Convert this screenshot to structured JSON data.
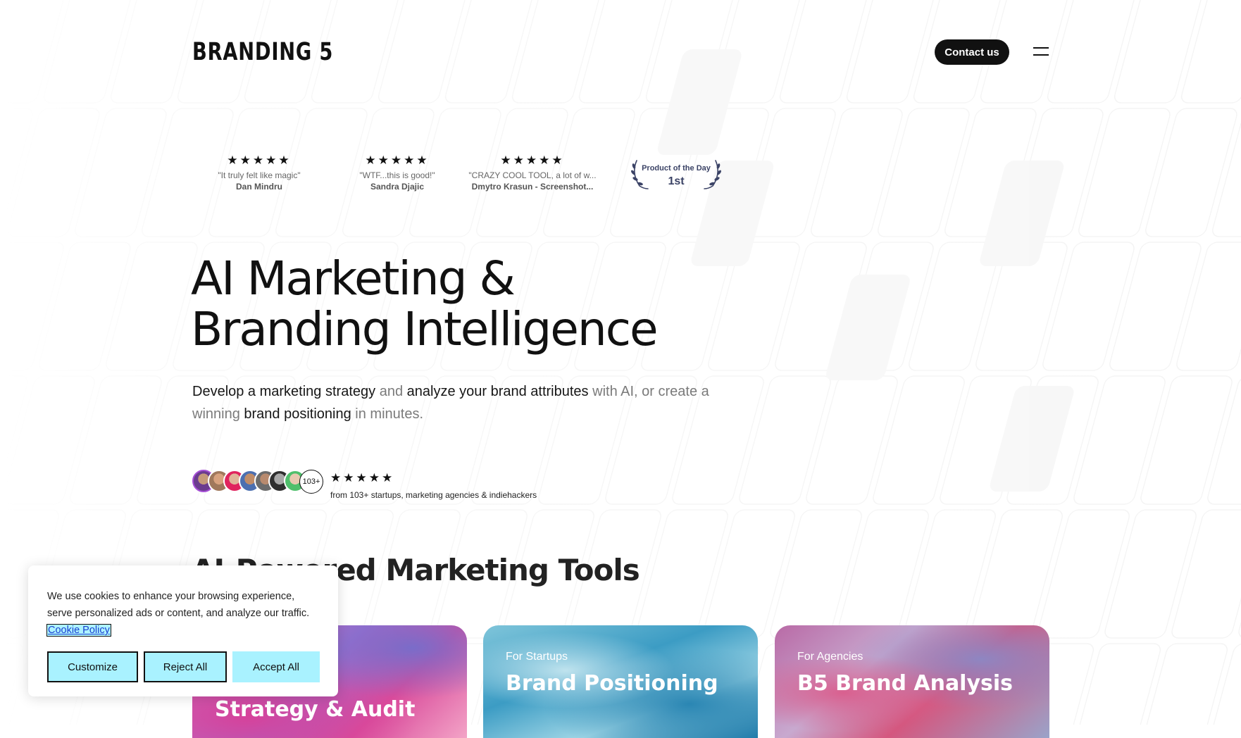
{
  "header": {
    "logo": "BRANDING 5",
    "contact_label": "Contact us",
    "menu_icon": "hamburger-menu-icon"
  },
  "reviews": [
    {
      "stars": "★★★★★",
      "rating": 5,
      "quote": "\"It truly felt like magic\"",
      "author": "Dan Mindru"
    },
    {
      "stars": "★★★★★",
      "rating": 5,
      "quote": "\"WTF...this is good!\"",
      "author": "Sandra Djajic"
    },
    {
      "stars": "★★★★★",
      "rating": 5,
      "quote": "\"CRAZY COOL TOOL, a lot of w...",
      "author": "Dmytro Krasun - Screenshot..."
    }
  ],
  "badge": {
    "label": "Product of the Day",
    "rank": "1st"
  },
  "hero": {
    "title_line1": "AI Marketing &",
    "title_line2": "Branding Intelligence",
    "sub": {
      "p1": "Develop a marketing strategy",
      "p2": " and ",
      "p3": "analyze your brand attributes",
      "p4": " with AI, or create a winning ",
      "p5": "brand positioning",
      "p6": " in minutes."
    }
  },
  "social_proof": {
    "avatar_count": "103+",
    "stars": "★★★★★",
    "rating": 5,
    "text": "from 103+ startups, marketing agencies & indiehackers"
  },
  "section": {
    "title": "AI-Powered Marketing Tools"
  },
  "cards": [
    {
      "eyebrow": "",
      "title": "Strategy & Audit"
    },
    {
      "eyebrow": "For Startups",
      "title": "Brand Positioning"
    },
    {
      "eyebrow": "For Agencies",
      "title": "B5 Brand Analysis"
    }
  ],
  "cookie": {
    "message": "We use cookies to enhance your browsing experience, serve personalized ads or content, and analyze our traffic.",
    "policy_link": "Cookie Policy",
    "customize": "Customize",
    "reject": "Reject All",
    "accept": "Accept All"
  },
  "colors": {
    "text": "#141414",
    "muted": "#7a7a7a",
    "button_dark": "#111111",
    "cookie_button": "#a9f2ff",
    "badge_text": "#3b4366"
  }
}
